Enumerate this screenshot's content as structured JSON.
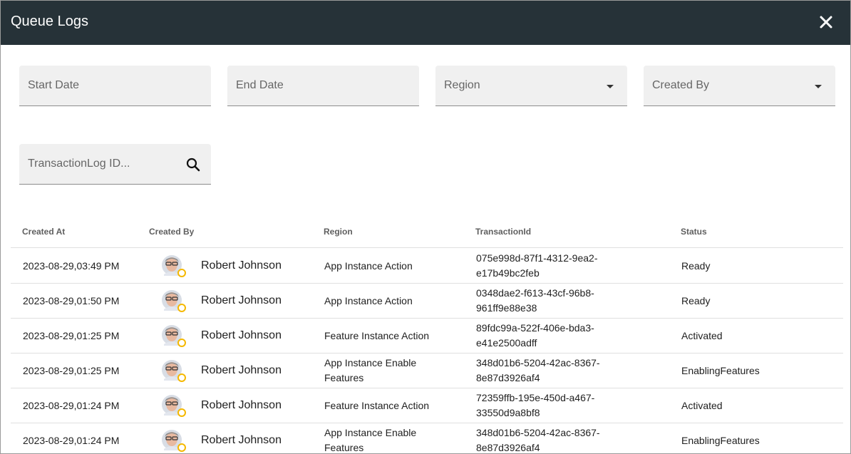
{
  "dialog": {
    "title": "Queue Logs"
  },
  "filters": {
    "start_date": "Start Date",
    "end_date": "End Date",
    "region": "Region",
    "created_by": "Created By",
    "transaction_search_placeholder": "TransactionLog ID..."
  },
  "table": {
    "columns": [
      "Created At",
      "Created By",
      "Region",
      "TransactionId",
      "Status"
    ],
    "rows": [
      {
        "created_at": "2023-08-29,03:49 PM",
        "created_by": "Robert Johnson",
        "region": "App Instance Action",
        "transaction_id": "075e998d-87f1-4312-9ea2-e17b49bc2feb",
        "status": "Ready"
      },
      {
        "created_at": "2023-08-29,01:50 PM",
        "created_by": "Robert Johnson",
        "region": "App Instance Action",
        "transaction_id": "0348dae2-f613-43cf-96b8-961ff9e88e38",
        "status": "Ready"
      },
      {
        "created_at": "2023-08-29,01:25 PM",
        "created_by": "Robert Johnson",
        "region": "Feature Instance Action",
        "transaction_id": "89fdc99a-522f-406e-bda3-e41e2500adff",
        "status": "Activated"
      },
      {
        "created_at": "2023-08-29,01:25 PM",
        "created_by": "Robert Johnson",
        "region": "App Instance Enable Features",
        "transaction_id": "348d01b6-5204-42ac-8367-8e87d3926af4",
        "status": "EnablingFeatures"
      },
      {
        "created_at": "2023-08-29,01:24 PM",
        "created_by": "Robert Johnson",
        "region": "Feature Instance Action",
        "transaction_id": "72359ffb-195e-450d-a467-33550d9a8bf8",
        "status": "Activated"
      },
      {
        "created_at": "2023-08-29,01:24 PM",
        "created_by": "Robert Johnson",
        "region": "App Instance Enable Features",
        "transaction_id": "348d01b6-5204-42ac-8367-8e87d3926af4",
        "status": "EnablingFeatures"
      }
    ]
  },
  "colors": {
    "header_bg": "#263238",
    "field_bg": "#f0f0f0",
    "status_dot": "#f5b800"
  },
  "icons": {
    "close": "close-icon",
    "dropdown": "caret-down-icon",
    "search": "search-icon",
    "avatar": "user-avatar",
    "status": "status-dot-icon"
  }
}
